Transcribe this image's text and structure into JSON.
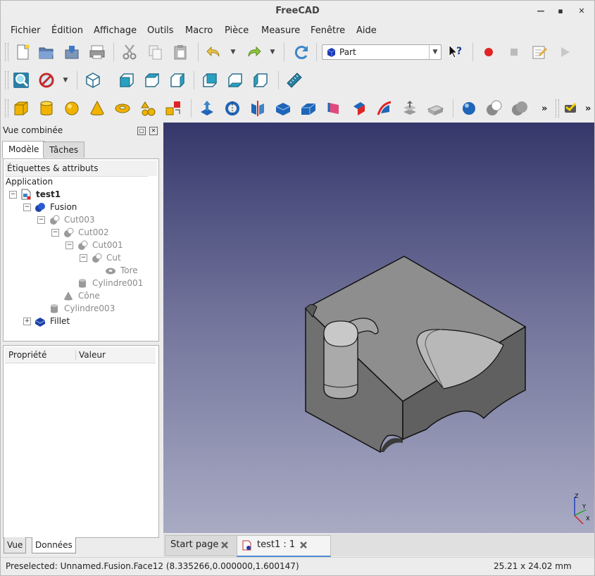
{
  "window": {
    "title": "FreeCAD"
  },
  "menu": [
    "Fichier",
    "Édition",
    "Affichage",
    "Outils",
    "Macro",
    "Pièce",
    "Measure",
    "Fenêtre",
    "Aide"
  ],
  "workbench": {
    "selected": "Part"
  },
  "toolbar_overflow": "»",
  "combo_view": {
    "title": "Vue combinée",
    "tabs": [
      "Modèle",
      "Tâches"
    ]
  },
  "tree": {
    "header": "Étiquettes & attributs",
    "section": "Application",
    "items": [
      {
        "label": "test1",
        "icon": "document-icon",
        "state": "normal",
        "expander": "minus"
      },
      {
        "label": "Fusion",
        "icon": "fusion-icon",
        "state": "normal",
        "expander": "minus"
      },
      {
        "label": "Cut003",
        "icon": "cut-icon",
        "state": "hidden",
        "expander": "minus"
      },
      {
        "label": "Cut002",
        "icon": "cut-icon",
        "state": "hidden",
        "expander": "minus"
      },
      {
        "label": "Cut001",
        "icon": "cut-icon",
        "state": "hidden",
        "expander": "minus"
      },
      {
        "label": "Cut",
        "icon": "cut-icon",
        "state": "hidden",
        "expander": "minus"
      },
      {
        "label": "Tore",
        "icon": "torus-icon",
        "state": "hidden",
        "expander": ""
      },
      {
        "label": "Cylindre001",
        "icon": "cylinder-icon",
        "state": "hidden",
        "expander": ""
      },
      {
        "label": "Cône",
        "icon": "cone-icon",
        "state": "hidden",
        "expander": ""
      },
      {
        "label": "Cylindre003",
        "icon": "cylinder-icon",
        "state": "hidden",
        "expander": ""
      },
      {
        "label": "Fillet",
        "icon": "fillet-icon",
        "state": "normal",
        "expander": "plus"
      }
    ]
  },
  "properties": {
    "col_property": "Propriété",
    "col_value": "Valeur",
    "tabs": [
      "Vue",
      "Données"
    ]
  },
  "axis_labels": {
    "x": "X",
    "y": "Y",
    "z": "Z"
  },
  "documents": {
    "tabs": [
      {
        "label": "Start page"
      },
      {
        "label": "test1 : 1"
      }
    ]
  },
  "status": {
    "message": "Preselected: Unnamed.Fusion.Face12 (8.335266,0.000000,1.600147)",
    "dimensions": "25.21 x 24.02 mm"
  },
  "colors": {
    "viewport_top": "#35376b",
    "viewport_bottom": "#a9abc4",
    "model_grey": "#8c8c8c",
    "active_tab": "#4f8fd6"
  }
}
